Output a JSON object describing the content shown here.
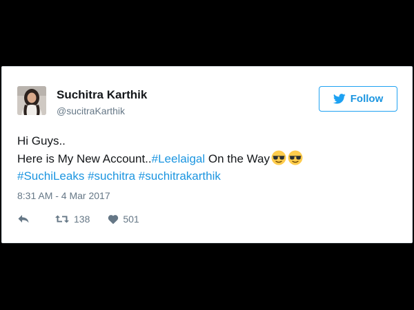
{
  "tweet": {
    "display_name": "Suchitra Karthik",
    "handle": "@sucitraKarthik",
    "follow_label": "Follow",
    "lines": [
      [
        {
          "text": "Hi Guys..",
          "type": "text"
        }
      ],
      [
        {
          "text": "Here is My New Account..",
          "type": "text"
        },
        {
          "text": "#Leelaigal",
          "type": "hashtag"
        },
        {
          "text": " On the Way",
          "type": "text"
        }
      ],
      [
        {
          "text": "#SuchiLeaks",
          "type": "hashtag"
        },
        {
          "text": " ",
          "type": "text"
        },
        {
          "text": "#suchitra",
          "type": "hashtag"
        },
        {
          "text": " ",
          "type": "text"
        },
        {
          "text": "#suchitrakarthik",
          "type": "hashtag"
        }
      ]
    ],
    "emojis": [
      "sunglasses-emoji",
      "sunglasses-emoji"
    ],
    "timestamp": "8:31 AM - 4 Mar 2017",
    "retweet_count": "138",
    "like_count": "501"
  },
  "icons": {
    "follow": "twitter-bird-icon",
    "reply": "reply-arrow-icon",
    "retweet": "retweet-icon",
    "like": "heart-icon"
  },
  "colors": {
    "link": "#1b95e0",
    "follow_border": "#1da1f2",
    "muted": "#657786",
    "text": "#14171a",
    "background": "#000000",
    "card": "#ffffff"
  }
}
